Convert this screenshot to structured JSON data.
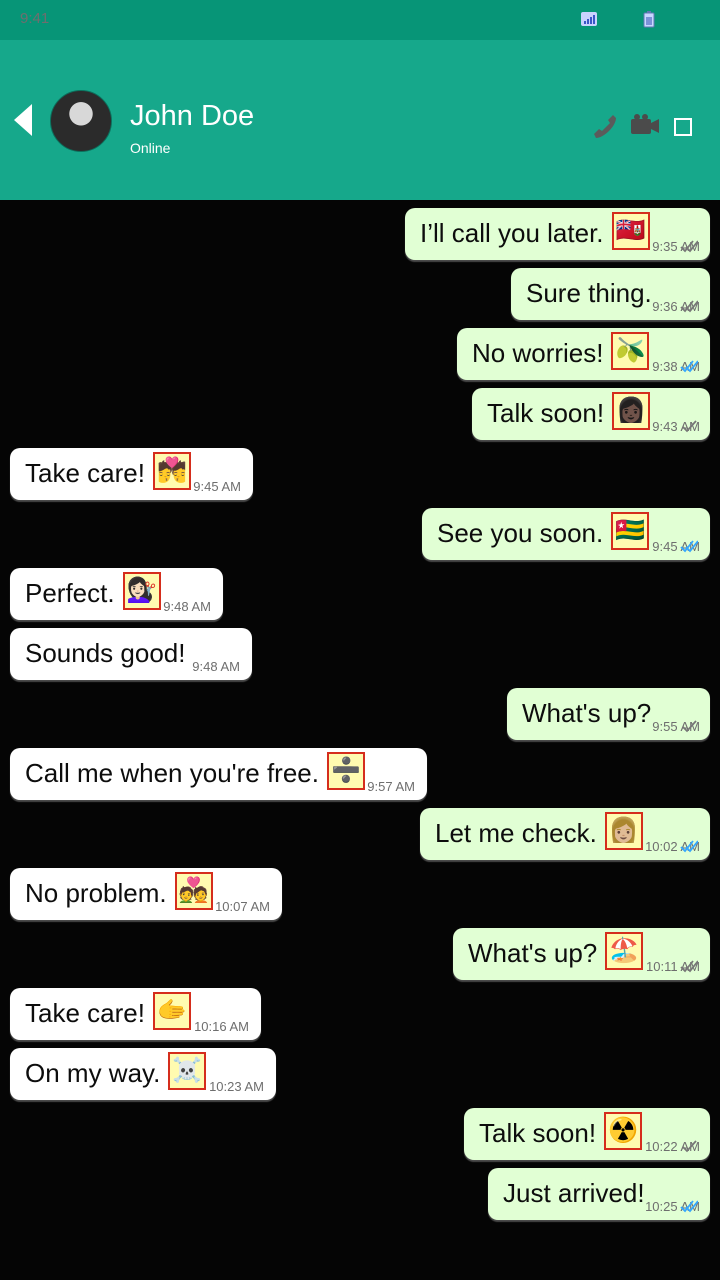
{
  "status_bar": {
    "time": "9:41"
  },
  "header": {
    "name": "John Doe",
    "status": "Online"
  },
  "messages": [
    {
      "dir": "out",
      "text": "I’ll call you later.",
      "emoji": "🇧🇲",
      "time": "9:35 AM",
      "ticks": "grey"
    },
    {
      "dir": "out",
      "text": "Sure thing.",
      "emoji": "",
      "time": "9:36 AM",
      "ticks": "grey"
    },
    {
      "dir": "out",
      "text": "No worries!",
      "emoji": "🫒",
      "time": "9:38 AM",
      "ticks": "blue"
    },
    {
      "dir": "out",
      "text": "Talk soon!",
      "emoji": "👩🏿",
      "time": "9:43 AM",
      "ticks": "grey-single"
    },
    {
      "dir": "in",
      "text": "Take care!",
      "emoji": "💏",
      "time": "9:45 AM"
    },
    {
      "dir": "out",
      "text": "See you soon.",
      "emoji": "🇹🇬",
      "time": "9:45 AM",
      "ticks": "blue"
    },
    {
      "dir": "in",
      "text": "Perfect.",
      "emoji": "💇🏻‍♀️",
      "time": "9:48 AM"
    },
    {
      "dir": "in",
      "text": "Sounds good!",
      "emoji": "",
      "time": "9:48 AM"
    },
    {
      "dir": "out",
      "text": "What's up?",
      "emoji": "",
      "time": "9:55 AM",
      "ticks": "grey-single"
    },
    {
      "dir": "in",
      "text": "Call me when you're free.",
      "emoji": "➗",
      "time": "9:57 AM"
    },
    {
      "dir": "out",
      "text": "Let me check.",
      "emoji": "👩🏼",
      "time": "10:02 AM",
      "ticks": "blue"
    },
    {
      "dir": "in",
      "text": "No problem.",
      "emoji": "💑",
      "time": "10:07 AM"
    },
    {
      "dir": "out",
      "text": "What's up?",
      "emoji": "🏖️",
      "time": "10:11 AM",
      "ticks": "grey"
    },
    {
      "dir": "in",
      "text": "Take care!",
      "emoji": "🫱",
      "time": "10:16 AM"
    },
    {
      "dir": "in",
      "text": "On my way.",
      "emoji": "☠️",
      "time": "10:23 AM"
    },
    {
      "dir": "out",
      "text": "Talk soon!",
      "emoji": "☢️",
      "time": "10:22 AM",
      "ticks": "grey-single"
    },
    {
      "dir": "out",
      "text": "Just arrived!",
      "emoji": "",
      "time": "10:25 AM",
      "ticks": "blue"
    }
  ],
  "colors": {
    "header": "#16a88b",
    "status_bar": "#079577",
    "outgoing": "#e1ffd4",
    "incoming": "#ffffff",
    "tick_blue": "#33a7ff",
    "tick_grey": "#777777"
  }
}
